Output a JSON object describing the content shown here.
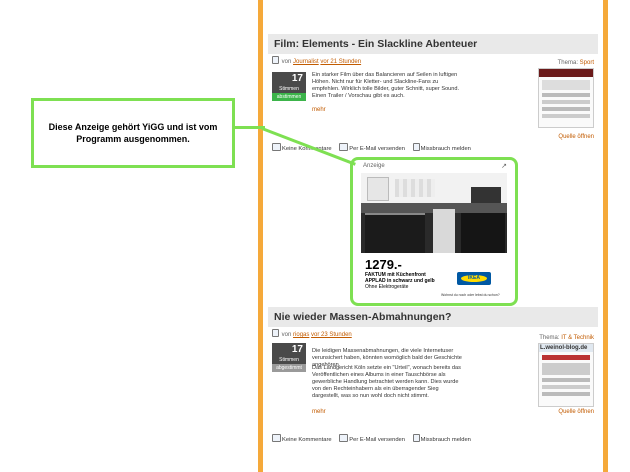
{
  "callout": {
    "text": "Diese Anzeige gehört YiGG und ist vom Programm ausgenommen."
  },
  "articles": [
    {
      "title": "Film: Elements - Ein Slackline Abenteuer",
      "byline_prefix": "von",
      "author": "Journalist",
      "time": "vor 21 Stunden",
      "theme_label": "Thema:",
      "theme": "Sport",
      "votes": "17",
      "votes_label": "Stimmen",
      "vote_button": "abstimmen",
      "body": "Ein starker Film über das Balancieren auf Seilen in luftigen Höhen. Nicht nur für Kletter- und Slackline-Fans zu empfehlen. Wirklich tolle Bilder, guter Schnitt, super Sound. Einen Trailer / Vorschau gibt es auch.",
      "more": "mehr",
      "source": "Quelle öffnen",
      "actions": [
        "Keine Kommentare",
        "Per E-Mail versenden",
        "Missbrauch melden"
      ]
    },
    {
      "title": "Nie wieder Massen-Abmahnungen?",
      "byline_prefix": "von",
      "author": "riogas",
      "time": "vor 23 Stunden",
      "theme_label": "Thema:",
      "theme": "IT & Technik",
      "votes": "17",
      "votes_label": "Stimmen",
      "vote_button": "abgestimmt",
      "body": "Die leidigen Massenabmahnungen, die viele Internetuser verunsichert haben, könnten womöglich bald der Geschichte angehören.",
      "body2": "Das Landgericht Köln setzte ein \"Urteil\", wonach bereits das Veröffentlichen eines Albums in einer Tauschbörse als gewerbliche Handlung betrachtet werden kann. Dies wurde von den Rechteinhabern als ein überragender Sieg dargestellt, was so nun wohl doch nicht stimmt.",
      "more": "mehr",
      "source": "Quelle öffnen",
      "thumb_text": "L.weinol-blog.de",
      "actions": [
        "Keine Kommentare",
        "Per E-Mail versenden",
        "Missbrauch melden"
      ]
    }
  ],
  "ad": {
    "label": "Anzeige",
    "price": "1279.-",
    "line1": "FAKTUM mit Küchenfront",
    "line2": "APPLAD in schwarz und gelb",
    "line3": "Ohne Elektrogeräte",
    "brand": "IKEA",
    "footer": "Wohnst du noch oder lebst du schon?"
  },
  "colors": {
    "accent": "#f5a93a",
    "highlight": "#7ee052",
    "link": "#c25b00"
  }
}
